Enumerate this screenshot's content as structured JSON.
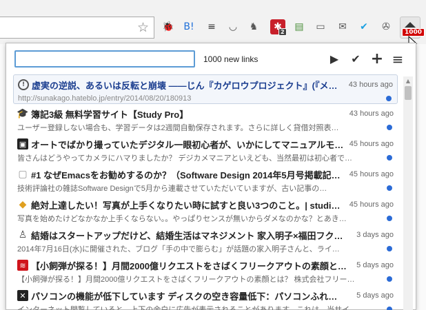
{
  "browser": {
    "extensions": [
      {
        "name": "bug-icon",
        "glyph": "🐞",
        "color": "#555"
      },
      {
        "name": "hatena-bookmark-icon",
        "glyph": "B!",
        "color": "#1e6fd9"
      },
      {
        "name": "buffer-icon",
        "glyph": "≡",
        "color": "#333"
      },
      {
        "name": "pocket-icon",
        "glyph": "◡",
        "color": "#555"
      },
      {
        "name": "evernote-icon",
        "glyph": "♞",
        "color": "#555"
      },
      {
        "name": "addon-red-icon",
        "glyph": "✱",
        "color": "#c8202b",
        "badge": "2"
      },
      {
        "name": "feed-icon",
        "glyph": "▤",
        "color": "#4a8f3a"
      },
      {
        "name": "reader-icon",
        "glyph": "▭",
        "color": "#555"
      },
      {
        "name": "mail-icon",
        "glyph": "✉",
        "color": "#555"
      },
      {
        "name": "checkbox-icon",
        "glyph": "✔",
        "color": "#1da1e2"
      },
      {
        "name": "satellite-icon",
        "glyph": "✇",
        "color": "#555"
      }
    ],
    "active_extension_badge": "1000"
  },
  "popup": {
    "search": {
      "value": "",
      "placeholder": ""
    },
    "new_links_label": "1000 new links",
    "controls": {
      "play": "▶",
      "check": "✔",
      "add": "+",
      "menu": "≡"
    },
    "items": [
      {
        "fav": "info",
        "favColor": "#555",
        "title": "虚実の逆説、あるいは反転と崩壊 ――じん『カゲロウプロジェクト』(『メカク…",
        "time": "43 hours ago",
        "snippet": "http://sunakago.hateblo.jp/entry/2014/08/20/180913",
        "selected": true
      },
      {
        "fav": "🎓",
        "favColor": "#2a8bd0",
        "title": "簿記3級 無料学習サイト【Study Pro】",
        "time": "43 hours ago",
        "snippet": "ユーザー登録しない場合も、学習データは2週間自動保存されます。さらに詳しく貸借対照表…",
        "selected": false
      },
      {
        "fav": "▣",
        "favColor": "#222",
        "title": "オートでばかり撮っていたデジタル一眼初心者が、いかにしてマニュアルモ…",
        "time": "45 hours ago",
        "snippet": "皆さんはどうやってカメラにハマりましたか？ デジカメマニアといえども、当然最初は初心者で…",
        "selected": false
      },
      {
        "fav": "▢",
        "favColor": "#999",
        "title": "#1 なぜEmacsをお勧めするのか？（Software Design 2014年5月号掲載記…",
        "time": "45 hours ago",
        "snippet": "技術評論社の雑誌Software Designで5月から連載させていただいていますが、古い記事の…",
        "selected": false
      },
      {
        "fav": "◆",
        "favColor": "#e0a020",
        "title": "絶対上達したい！写真が上手くなりたい時に試すと良い3つのこと。| studi…",
        "time": "45 hours ago",
        "snippet": "写真を始めたけどなかなか上手くならない。。やっぱりセンスが無いからダメなのかな？とあき…",
        "selected": false
      },
      {
        "fav": "♙",
        "favColor": "#444",
        "title": "結婚はスタートアップだけど、結婚生活はマネジメント 家入明子×福田フク…",
        "time": "3 days ago",
        "snippet": "2014年7月16日(水)に開催された、ブログ「手の中で膨らむ」が話題の家入明子さんと、ライ…",
        "selected": false
      },
      {
        "fav": "≋",
        "favColor": "#d0141c",
        "title": "【小飼弾が探る！】月間2000億リクエストをさばくフリークアウトの素顔とは…",
        "time": "5 days ago",
        "snippet": "【小飼弾が探る！】月間2000億リクエストをさばくフリークアウトの素顔とは？ 株式会社フリー…",
        "selected": false
      },
      {
        "fav": "✕",
        "favColor": "#222",
        "title": "パソコンの機能が低下しています ディスクの空き容量低下：パソコンふれ…",
        "time": "5 days ago",
        "snippet": "インターネット閲覧していると、上下の余白に広告が表示されることがあります。これは、当サイ…",
        "selected": false
      }
    ]
  }
}
